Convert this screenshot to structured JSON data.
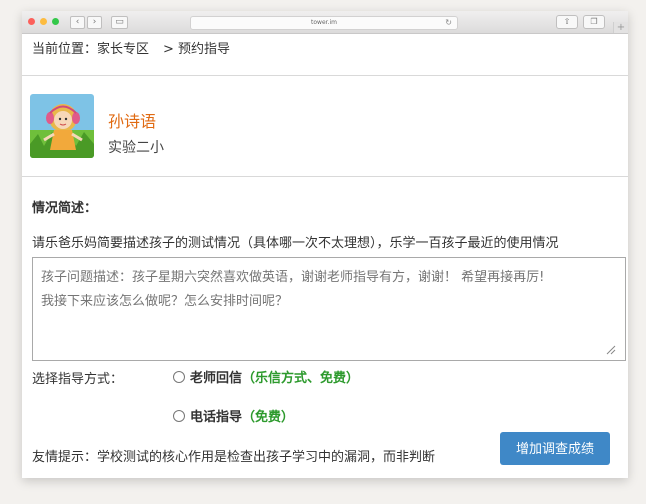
{
  "browser": {
    "url": "tower.im",
    "colors": {
      "close": "#fc605b",
      "minimize": "#fdbc40",
      "zoom": "#34c84a"
    }
  },
  "breadcrumb": {
    "prefix": "当前位置：",
    "link": "家长专区",
    "sep": ">",
    "current": "预约指导"
  },
  "profile": {
    "name": "孙诗语",
    "school": "实验二小"
  },
  "description": {
    "title": "情况简述：",
    "hint": "请乐爸乐妈简要描述孩子的测试情况（具体哪一次不太理想），乐学一百孩子最近的使用情况",
    "placeholder": "孩子问题描述：孩子星期六突然喜欢做英语，谢谢老师指导有方，谢谢！ 希望再接再厉!\n我接下来应该怎么做呢？怎么安排时间呢？"
  },
  "guidance": {
    "label": "选择指导方式：",
    "options": [
      {
        "name": "老师回信",
        "note": "（乐信方式、免费）"
      },
      {
        "name": "电话指导",
        "note": "（免费）"
      }
    ]
  },
  "footer": {
    "tip": "友情提示：学校测试的核心作用是检查出孩子学习中的漏洞，而非判断",
    "submit_label": "增加调查成绩"
  },
  "colors": {
    "accent_name": "#e06a12",
    "note_green": "#2d9a2d",
    "button_blue": "#3f88c7"
  }
}
